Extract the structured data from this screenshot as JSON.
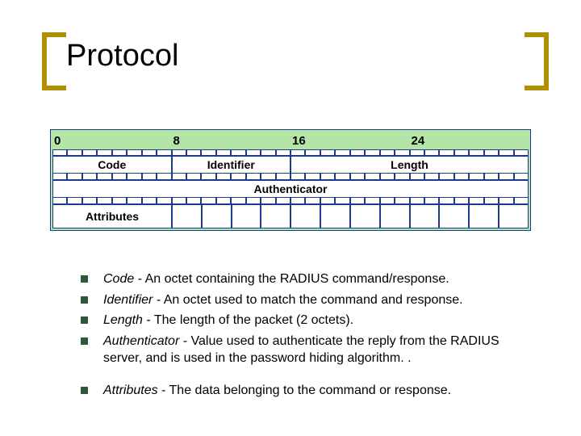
{
  "title": "Protocol",
  "diagram": {
    "ruler": [
      "0",
      "8",
      "16",
      "24"
    ],
    "row1": [
      "Code",
      "Identifier",
      "Length"
    ],
    "row2": "Authenticator",
    "row3": "Attributes"
  },
  "bullets_group1": [
    {
      "term": "Code",
      "text": " - An octet containing the RADIUS command/response."
    },
    {
      "term": "Identifier",
      "text": " - An octet used to match the command and response."
    },
    {
      "term": "Length",
      "text": " - The length of the packet (2 octets)."
    },
    {
      "term": "Authenticator",
      "text": " - Value used to authenticate the reply from the RADIUS server, and is used in the password hiding algorithm. ."
    }
  ],
  "bullets_group2": [
    {
      "term": "Attributes",
      "text": " - The data belonging to the command or response."
    }
  ]
}
